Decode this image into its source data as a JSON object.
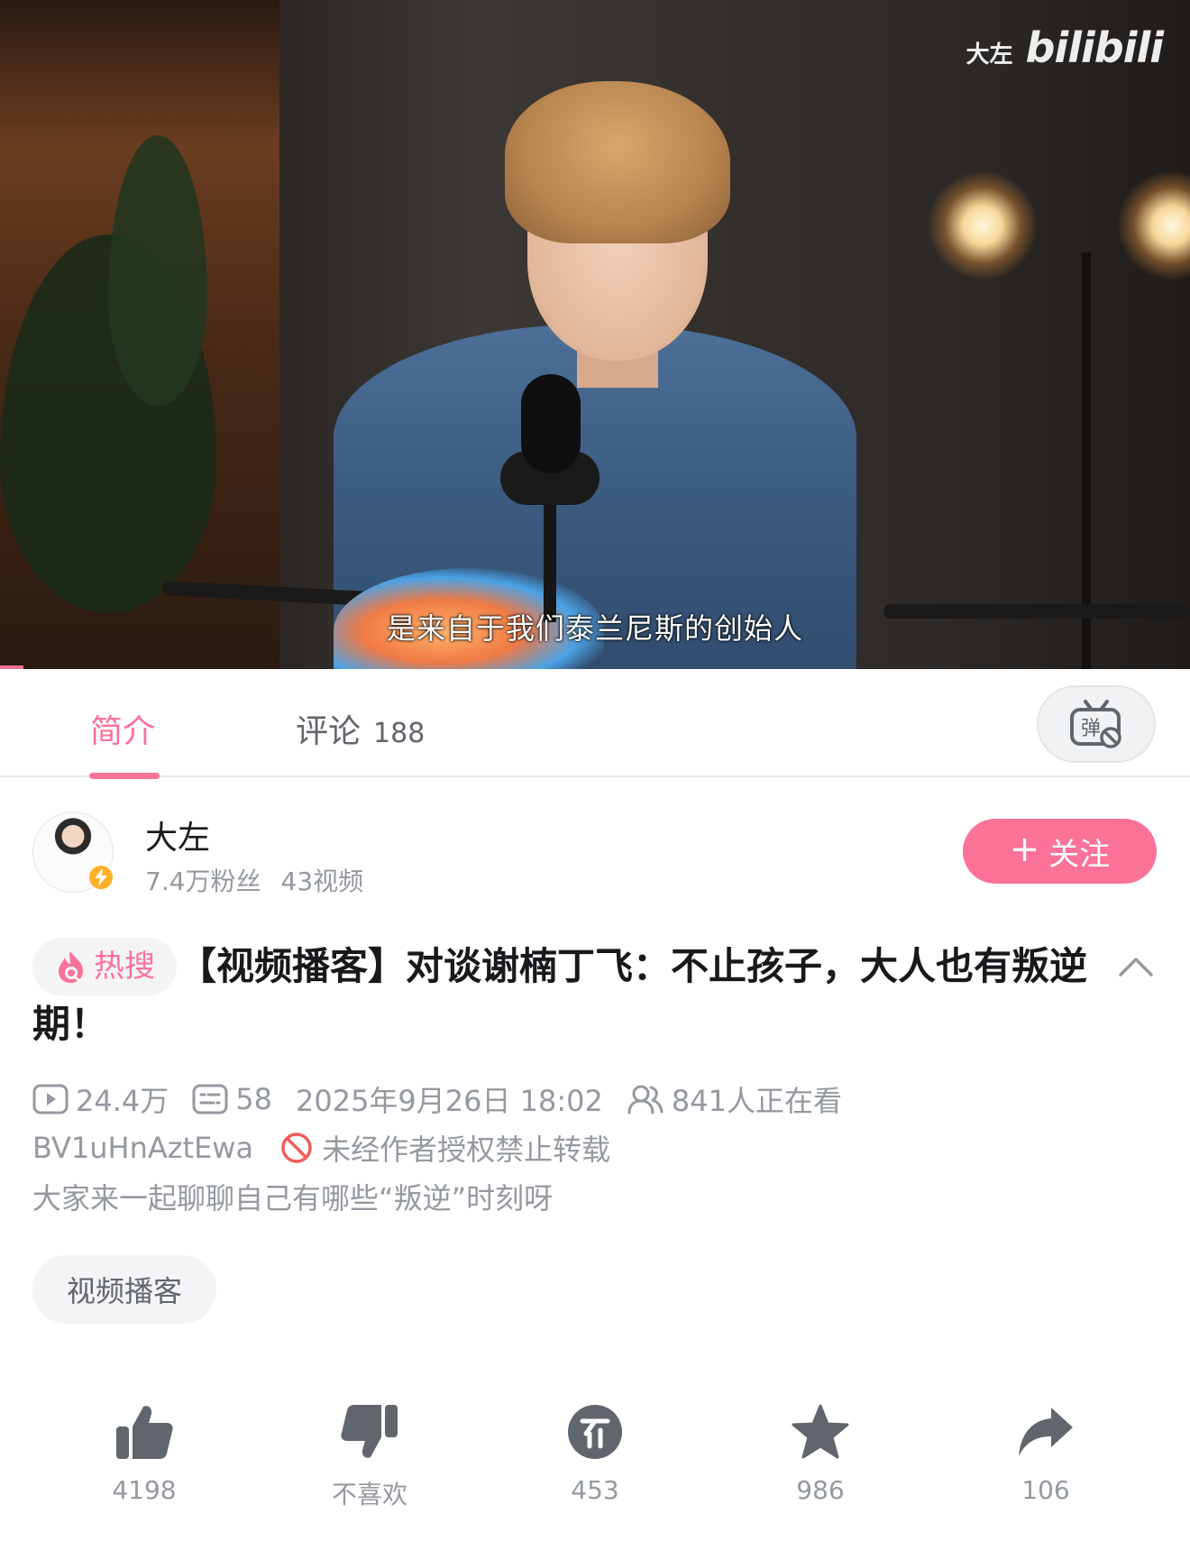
{
  "video": {
    "subtitle": "是来自于我们泰兰尼斯的创始人",
    "watermark_user": "大左",
    "watermark_logo": "bilibili"
  },
  "tabs": {
    "intro_label": "简介",
    "comments_label": "评论",
    "comments_count": "188",
    "danmaku_icon": "danmaku-toggle-icon"
  },
  "uploader": {
    "name": "大左",
    "fans": "7.4万粉丝",
    "videos": "43视频",
    "follow_label": "关注"
  },
  "video_info": {
    "hot_tag": "热搜",
    "title": "【视频播客】对谈谢楠丁飞：不止孩子，大人也有叛逆期！",
    "views": "24.4万",
    "danmaku_count": "58",
    "publish_time": "2025年9月26日 18:02",
    "watching": "841人正在看",
    "bvid": "BV1uHnAztEwa",
    "copyright": "未经作者授权禁止转载",
    "description": "大家来一起聊聊自己有哪些“叛逆”时刻呀",
    "tags": [
      "视频播客"
    ]
  },
  "actions": {
    "like": "4198",
    "dislike": "不喜欢",
    "coin": "453",
    "favorite": "986",
    "share": "106"
  },
  "colors": {
    "accent": "#fb7299",
    "text_secondary": "#9499a0",
    "chip_bg": "#f4f4f6"
  }
}
